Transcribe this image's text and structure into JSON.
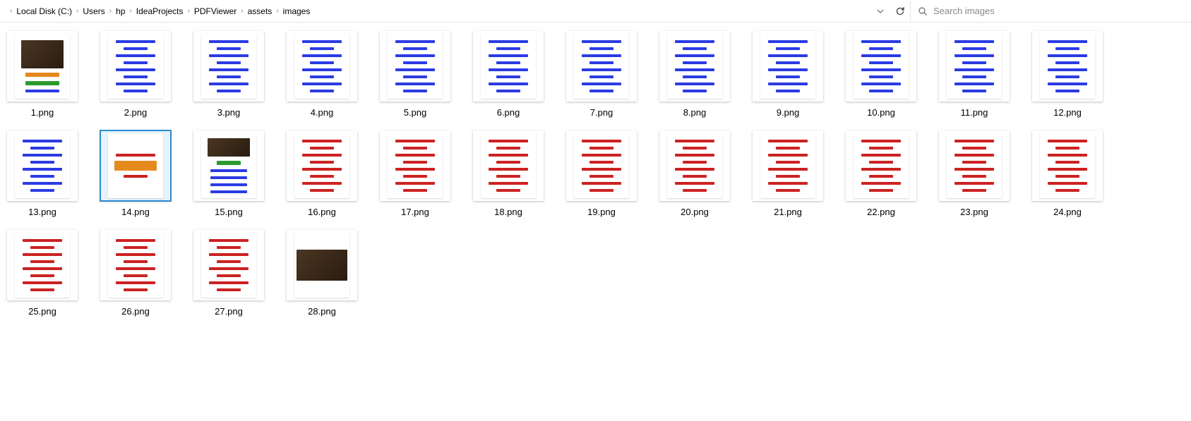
{
  "breadcrumb": [
    "Local Disk (C:)",
    "Users",
    "hp",
    "IdeaProjects",
    "PDFViewer",
    "assets",
    "images"
  ],
  "search": {
    "placeholder": "Search images"
  },
  "selected_filename": "14.png",
  "files": [
    {
      "name": "1.png",
      "kind": "poster"
    },
    {
      "name": "2.png",
      "kind": "bluetext"
    },
    {
      "name": "3.png",
      "kind": "bluetext"
    },
    {
      "name": "4.png",
      "kind": "bluetext"
    },
    {
      "name": "5.png",
      "kind": "bluetext"
    },
    {
      "name": "6.png",
      "kind": "bluetext"
    },
    {
      "name": "7.png",
      "kind": "bluetext"
    },
    {
      "name": "8.png",
      "kind": "bluetext"
    },
    {
      "name": "9.png",
      "kind": "bluetext"
    },
    {
      "name": "10.png",
      "kind": "bluetext"
    },
    {
      "name": "11.png",
      "kind": "bluetext"
    },
    {
      "name": "12.png",
      "kind": "bluetext"
    },
    {
      "name": "13.png",
      "kind": "bluetext"
    },
    {
      "name": "14.png",
      "kind": "poster2"
    },
    {
      "name": "15.png",
      "kind": "poster3"
    },
    {
      "name": "16.png",
      "kind": "redtext"
    },
    {
      "name": "17.png",
      "kind": "redtext"
    },
    {
      "name": "18.png",
      "kind": "redtext"
    },
    {
      "name": "19.png",
      "kind": "redtext"
    },
    {
      "name": "20.png",
      "kind": "redtext"
    },
    {
      "name": "21.png",
      "kind": "redtext"
    },
    {
      "name": "22.png",
      "kind": "redtext"
    },
    {
      "name": "23.png",
      "kind": "redtext"
    },
    {
      "name": "24.png",
      "kind": "redtext"
    },
    {
      "name": "25.png",
      "kind": "redtext"
    },
    {
      "name": "26.png",
      "kind": "redtext"
    },
    {
      "name": "27.png",
      "kind": "redtext"
    },
    {
      "name": "28.png",
      "kind": "darkimg"
    }
  ]
}
